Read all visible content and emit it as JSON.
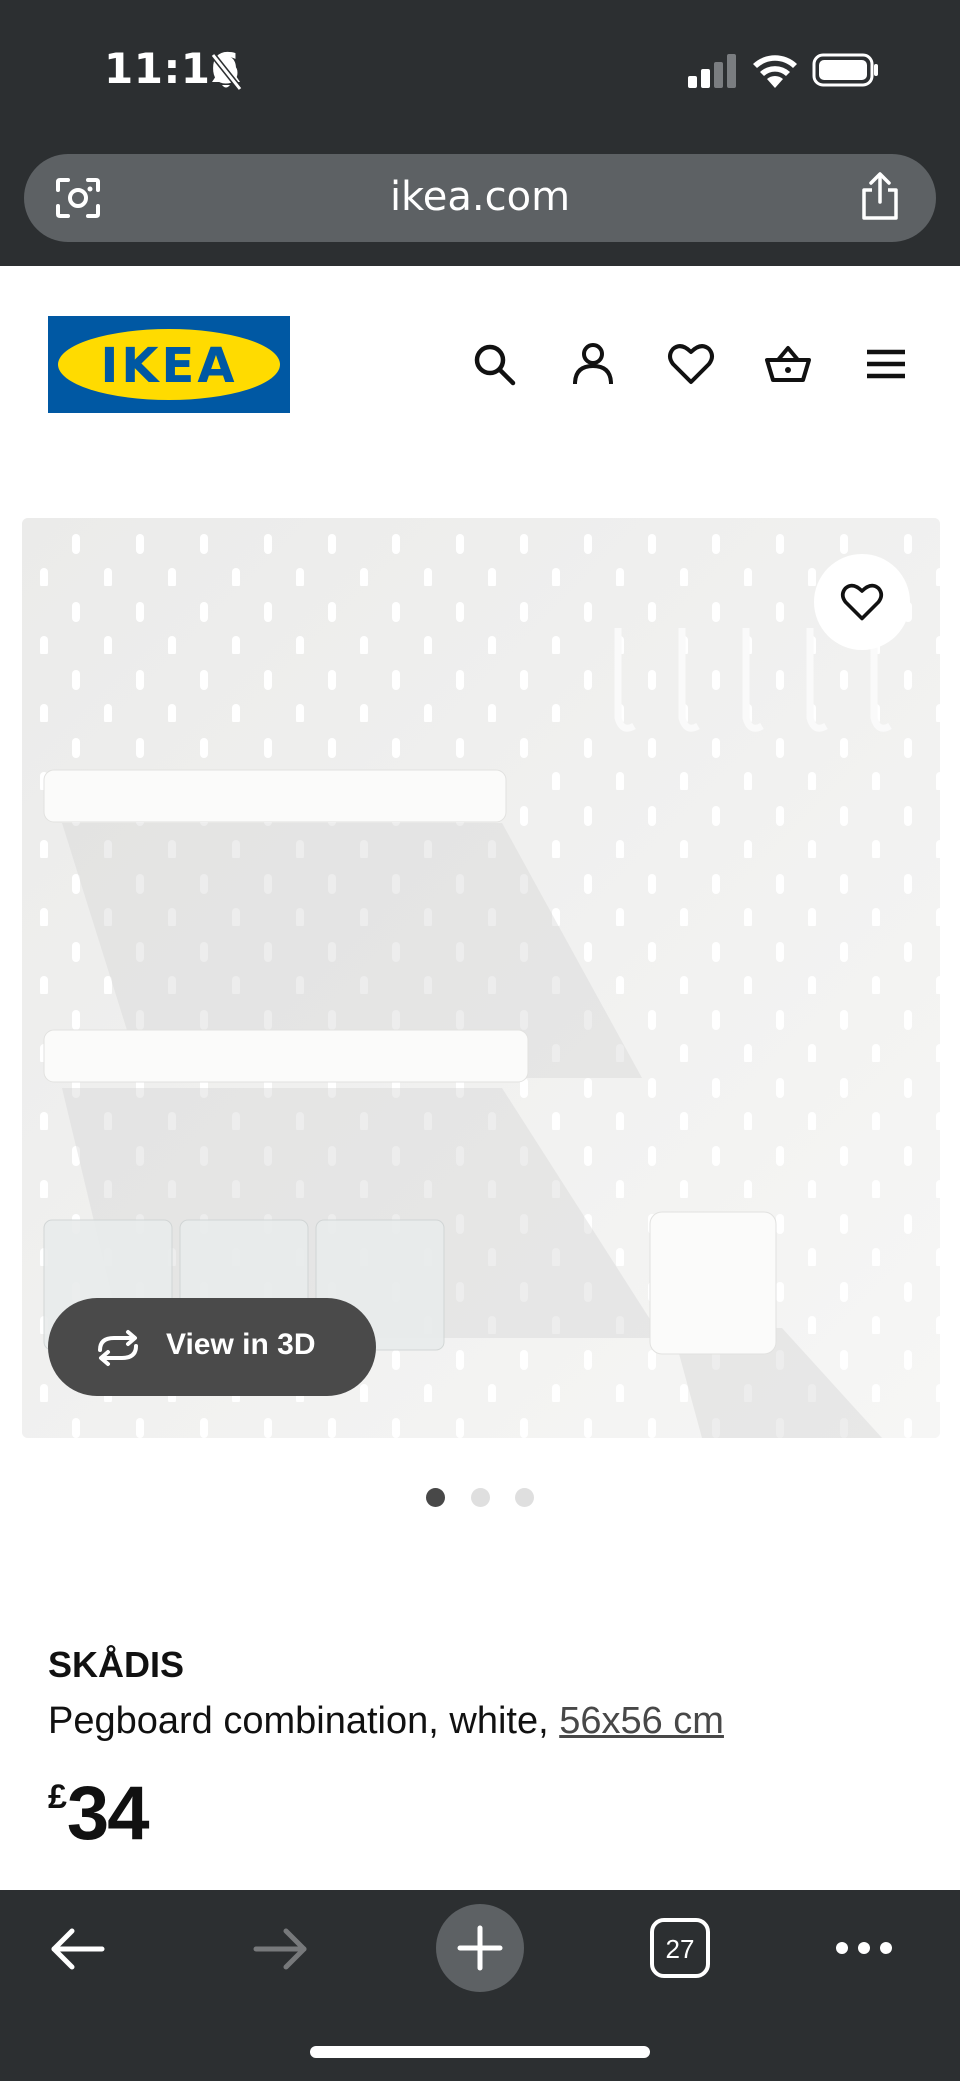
{
  "status_bar": {
    "time": "11:16"
  },
  "browser": {
    "url": "ikea.com",
    "tab_count": "27"
  },
  "site": {
    "logo_text": "IKEA",
    "brand_blue": "#0058a3",
    "brand_yellow": "#ffdb00"
  },
  "header_icons": [
    "search-icon",
    "account-icon",
    "heart-icon",
    "basket-icon",
    "menu-icon"
  ],
  "gallery": {
    "view_3d_label": "View in 3D",
    "image_count": 3,
    "active_image": 1
  },
  "product": {
    "name": "SKÅDIS",
    "description": "Pegboard combination, white, ",
    "size_link": "56x56 cm",
    "price_currency": "£",
    "price_amount": "34"
  }
}
